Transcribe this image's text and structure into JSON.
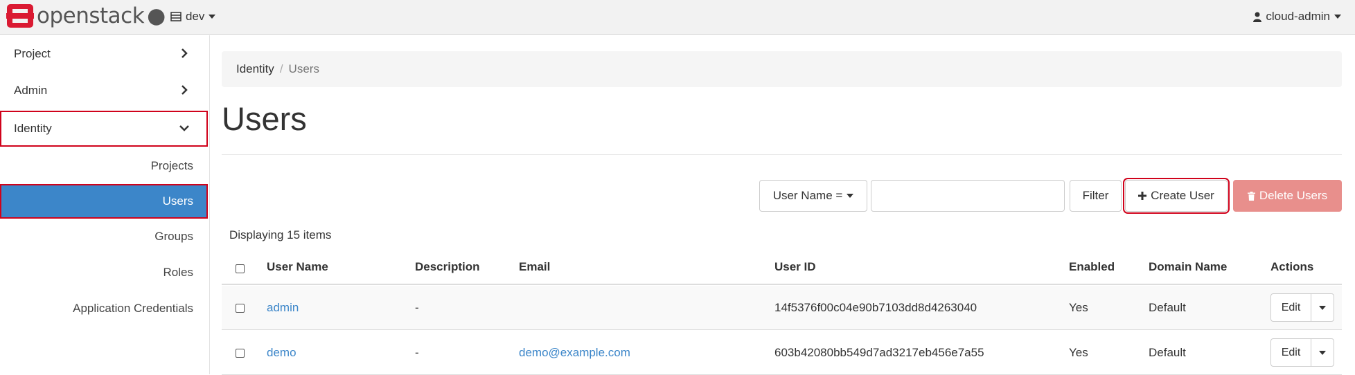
{
  "topbar": {
    "brand": "openstack",
    "project": "dev",
    "user": "cloud-admin"
  },
  "sidebar": {
    "items": [
      {
        "label": "Project",
        "state": "collapsed"
      },
      {
        "label": "Admin",
        "state": "collapsed"
      },
      {
        "label": "Identity",
        "state": "expanded"
      }
    ],
    "sub_items": [
      {
        "label": "Projects"
      },
      {
        "label": "Users",
        "active": true
      },
      {
        "label": "Groups"
      },
      {
        "label": "Roles"
      },
      {
        "label": "Application Credentials"
      }
    ]
  },
  "breadcrumb": {
    "parent": "Identity",
    "separator": "/",
    "current": "Users"
  },
  "page_title": "Users",
  "toolbar": {
    "filter_field": "User Name =",
    "filter_value": "",
    "filter_label": "Filter",
    "create_label": "Create User",
    "delete_label": "Delete Users"
  },
  "table": {
    "count_text": "Displaying 15 items",
    "columns": [
      "User Name",
      "Description",
      "Email",
      "User ID",
      "Enabled",
      "Domain Name",
      "Actions"
    ],
    "rows": [
      {
        "name": "admin",
        "description": "-",
        "email": "",
        "user_id": "14f5376f00c04e90b7103dd8d4263040",
        "enabled": "Yes",
        "domain": "Default",
        "action": "Edit"
      },
      {
        "name": "demo",
        "description": "-",
        "email": "demo@example.com",
        "user_id": "603b42080bb549d7ad3217eb456e7a55",
        "enabled": "Yes",
        "domain": "Default",
        "action": "Edit"
      }
    ]
  },
  "colors": {
    "accent": "#3c86c9",
    "danger": "#e88f8c",
    "highlight": "#d0021b",
    "brand_red": "#da1a32"
  }
}
